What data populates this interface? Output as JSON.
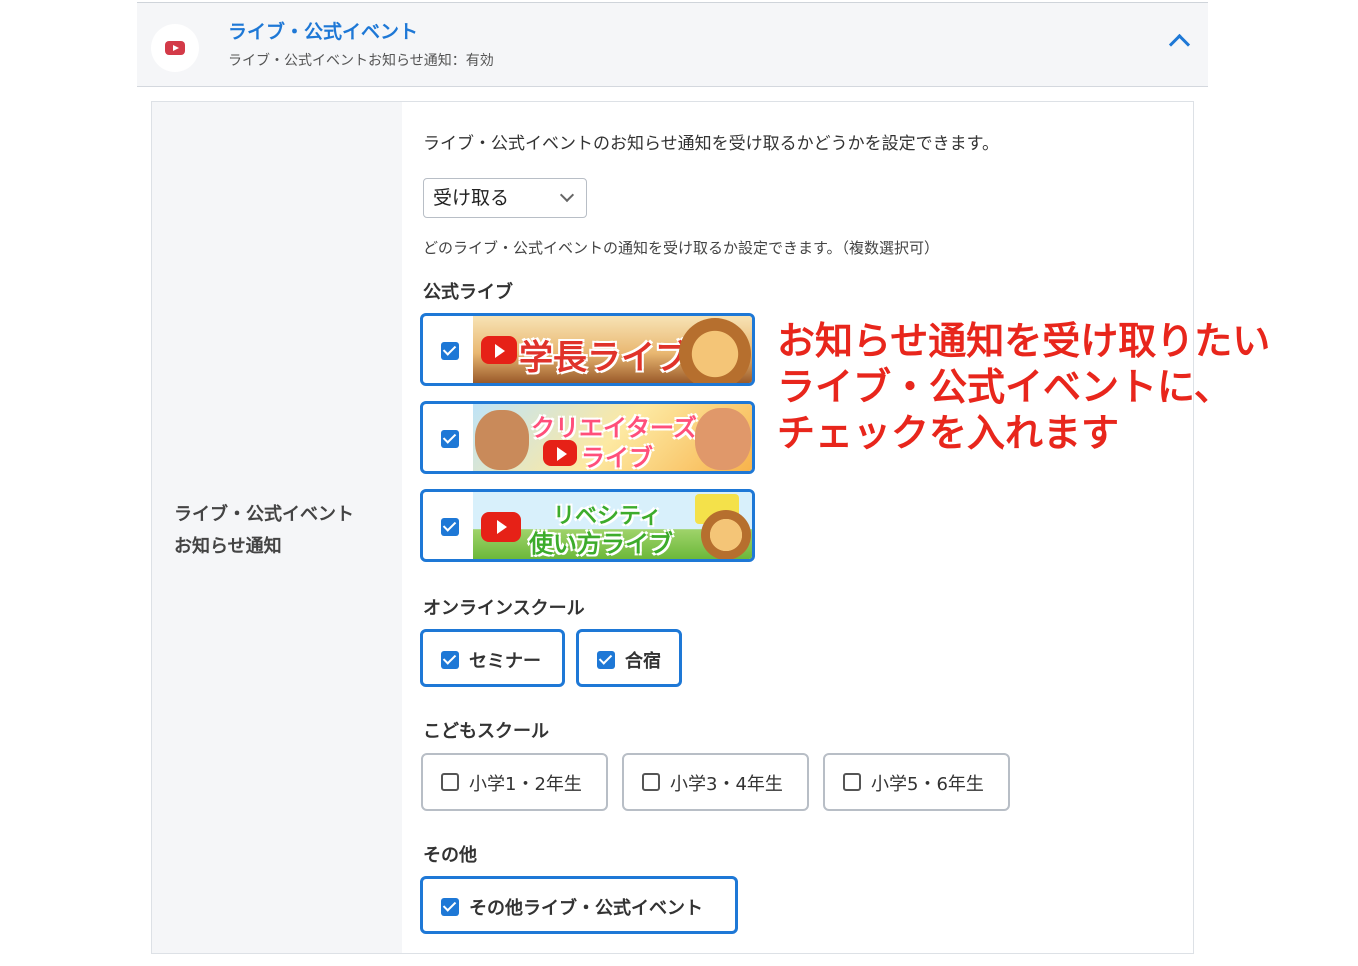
{
  "header": {
    "title": "ライブ・公式イベント",
    "subtitle": "ライブ・公式イベントお知らせ通知：有効"
  },
  "setting": {
    "label_line1": "ライブ・公式イベント",
    "label_line2": "お知らせ通知",
    "description": "ライブ・公式イベントのお知らせ通知を受け取るかどうかを設定できます。",
    "select_value": "受け取る",
    "multi_description": "どのライブ・公式イベントの通知を受け取るか設定できます。（複数選択可）"
  },
  "sections": {
    "official_live": {
      "title": "公式ライブ",
      "banners": [
        {
          "text": "学長ライブ",
          "checked": true
        },
        {
          "text_line1": "クリエイターズ",
          "text_line2": "ライブ",
          "checked": true
        },
        {
          "text_line1": "リベシティ",
          "text_line2": "使い方ライブ",
          "checked": true
        }
      ]
    },
    "online_school": {
      "title": "オンラインスクール",
      "items": [
        {
          "label": "セミナー",
          "checked": true
        },
        {
          "label": "合宿",
          "checked": true
        }
      ]
    },
    "kids_school": {
      "title": "こどもスクール",
      "items": [
        {
          "label": "小学1・2年生",
          "checked": false
        },
        {
          "label": "小学3・4年生",
          "checked": false
        },
        {
          "label": "小学5・6年生",
          "checked": false
        }
      ]
    },
    "other": {
      "title": "その他",
      "items": [
        {
          "label": "その他ライブ・公式イベント",
          "checked": true
        }
      ]
    }
  },
  "annotation": {
    "line1": "お知らせ通知を受け取りたい",
    "line2": "ライブ・公式イベントに、",
    "line3": "チェックを入れます"
  },
  "colors": {
    "accent": "#1e78d6",
    "annotation": "#e8261c",
    "youtube": "#e62117"
  }
}
